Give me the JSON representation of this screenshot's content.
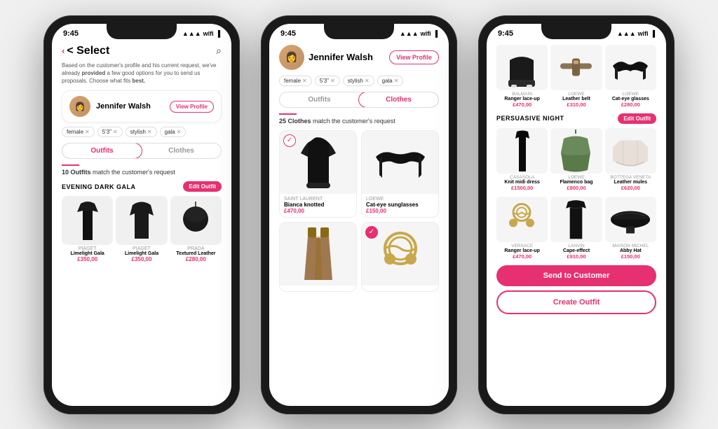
{
  "phone1": {
    "status_time": "9:45",
    "header_back": "< Select",
    "description": "Based on the customer's profile and his current request, we've already provided a few good options for you to send us proposals. Choose what fits best.",
    "profile_name": "Jennifer Walsh",
    "view_profile": "View Profile",
    "tags": [
      "female",
      "5'3\"",
      "stylish",
      "gala"
    ],
    "tab_outfits": "Outfits",
    "tab_clothes": "Clothes",
    "match_text": "10 Outfits match the customer's request",
    "outfit_label": "EVENING DARK GALA",
    "edit_outfit": "Edit Outfit",
    "items": [
      {
        "brand": "PIAGET",
        "name": "Limelight Gala",
        "price": "£350,00",
        "emoji": "👗"
      },
      {
        "brand": "PIAGET",
        "name": "Limelight Gala",
        "price": "£350,00",
        "emoji": "🧥"
      },
      {
        "brand": "PRADA",
        "name": "Textured Leather",
        "price": "£280,00",
        "emoji": "👜"
      }
    ]
  },
  "phone2": {
    "status_time": "9:45",
    "profile_name": "Jennifer Walsh",
    "view_profile": "View Profile",
    "tags": [
      "female",
      "5'3\"",
      "stylish",
      "gala"
    ],
    "tab_outfits": "Outfits",
    "tab_clothes": "Clothes",
    "match_text": "25 Clothes match the customer's request",
    "item1_brand": "SAINT LAURENT",
    "item1_name": "Bianca knotted",
    "item1_price": "£470,00",
    "item1_emoji": "👠",
    "item2_brand": "LOEWE",
    "item2_name": "Cat-eye sunglasses",
    "item2_price": "£150,00",
    "item2_emoji": "🕶️",
    "item3_emoji": "👖",
    "item4_emoji": "📿"
  },
  "phone3": {
    "status_time": "9:45",
    "top_items": [
      {
        "brand": "BALMAIN",
        "name": "Ranger lace-up",
        "price": "£470,00",
        "emoji": "👟"
      },
      {
        "brand": "LOEWE",
        "name": "Leather belt",
        "price": "£310,00",
        "emoji": "👜"
      },
      {
        "brand": "LOEWE",
        "name": "Cat-eye glasses",
        "price": "£280,00",
        "emoji": "🕶️"
      }
    ],
    "section_label": "PERSUASIVE NIGHT",
    "edit_outfit": "Edit Outfit",
    "mid_items": [
      {
        "brand": "CASASOLA",
        "name": "Knit midi dress",
        "price": "£1500,00",
        "emoji": "👗"
      },
      {
        "brand": "LOEWE",
        "name": "Flamenco bag",
        "price": "£800,00",
        "emoji": "👜"
      },
      {
        "brand": "BOTTEGA VENETA",
        "name": "Leather mules",
        "price": "£620,00",
        "emoji": "👡"
      }
    ],
    "bottom_items": [
      {
        "brand": "VERSACE",
        "name": "Ranger lace-up",
        "price": "£470,00",
        "emoji": "📿"
      },
      {
        "brand": "LANVIN",
        "name": "Cape-effect",
        "price": "£910,00",
        "emoji": "🧥"
      },
      {
        "brand": "MAISON MICHEL",
        "name": "Abby Hat",
        "price": "£150,00",
        "emoji": "🎩"
      }
    ],
    "send_btn": "Send to Customer",
    "create_btn": "Create Outfit"
  }
}
